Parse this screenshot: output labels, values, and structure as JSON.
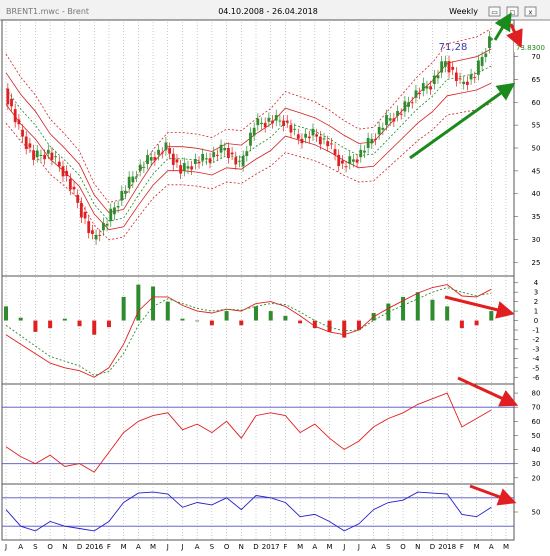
{
  "window": {
    "title": "BRENT1.mwc - Brent",
    "date_range": "04.10.2008 - 26.04.2018",
    "period": "Weekly",
    "btn_minimize": "▭",
    "btn_maximize": "◻",
    "btn_close": "x"
  },
  "colors": {
    "bull_candle": "#2e8b2e",
    "bear_candle": "#e02020",
    "neutral_candle": "#1f2fbf",
    "bands": "#d42020",
    "arrow_green": "#1a8a1a",
    "arrow_red": "#e02020",
    "grid": "#9a9a9a",
    "level_line": "#5050c8",
    "rsi_line": "#e02020",
    "stoch_line": "#2020c8"
  },
  "chart_data": [
    {
      "type": "candlestick",
      "name": "price",
      "yticks": [
        25,
        30,
        35,
        40,
        45,
        50,
        55,
        60,
        65,
        70
      ],
      "ylim": [
        22,
        78
      ],
      "last_price_label": "73.8300",
      "annotations": [
        {
          "text": "71,28"
        }
      ],
      "x": [
        "2015-07",
        "2015-08",
        "2015-09",
        "2015-10",
        "2015-11",
        "2015-12",
        "2016-01",
        "2016-02",
        "2016-03",
        "2016-04",
        "2016-05",
        "2016-06",
        "2016-07",
        "2016-08",
        "2016-09",
        "2016-10",
        "2016-11",
        "2016-12",
        "2017-01",
        "2017-02",
        "2017-03",
        "2017-04",
        "2017-05",
        "2017-06",
        "2017-07",
        "2017-08",
        "2017-09",
        "2017-10",
        "2017-11",
        "2017-12",
        "2018-01",
        "2018-02",
        "2018-03",
        "2018-04"
      ],
      "close": [
        63,
        54,
        48,
        49,
        45,
        38,
        30,
        34,
        40,
        45,
        48,
        50,
        45,
        47,
        48,
        50,
        46,
        55,
        56,
        56,
        52,
        53,
        51,
        46,
        48,
        52,
        56,
        58,
        62,
        64,
        69,
        64,
        66,
        73.83
      ]
    },
    {
      "type": "histogram+line",
      "name": "momentum oscillator",
      "yticks": [
        4,
        3,
        2,
        1,
        0,
        -1,
        -2,
        -3,
        -4,
        -5,
        -6
      ],
      "ylim": [
        -6.5,
        4.5
      ],
      "x": [
        "2015-07",
        "2015-08",
        "2015-09",
        "2015-10",
        "2015-11",
        "2015-12",
        "2016-01",
        "2016-02",
        "2016-03",
        "2016-04",
        "2016-05",
        "2016-06",
        "2016-07",
        "2016-08",
        "2016-09",
        "2016-10",
        "2016-11",
        "2016-12",
        "2017-01",
        "2017-02",
        "2017-03",
        "2017-04",
        "2017-05",
        "2017-06",
        "2017-07",
        "2017-08",
        "2017-09",
        "2017-10",
        "2017-11",
        "2017-12",
        "2018-01",
        "2018-02",
        "2018-03",
        "2018-04"
      ],
      "histogram": [
        1.5,
        0.3,
        -1.2,
        -0.8,
        0.2,
        -0.6,
        -1.5,
        -0.7,
        2.5,
        3.8,
        3.6,
        2.0,
        0.2,
        0.0,
        -0.5,
        1.0,
        -0.5,
        1.5,
        1.0,
        0.5,
        -0.3,
        -0.8,
        -1.2,
        -1.8,
        -1.0,
        0.8,
        1.8,
        2.5,
        3.0,
        2.2,
        1.5,
        -0.8,
        -0.5,
        1.0
      ],
      "line1": [
        -1.5,
        -2.5,
        -3.5,
        -4.5,
        -5.0,
        -5.3,
        -6.0,
        -5.0,
        -2.5,
        1.0,
        2.5,
        2.5,
        1.6,
        1.0,
        0.8,
        1.2,
        1.0,
        1.8,
        2.0,
        1.5,
        0.5,
        -0.6,
        -1.2,
        -1.5,
        -1.0,
        0.4,
        1.3,
        2.1,
        2.9,
        3.5,
        3.8,
        2.6,
        2.5,
        3.3
      ],
      "line2": [
        -0.5,
        -1.6,
        -2.7,
        -3.8,
        -4.3,
        -4.8,
        -5.8,
        -5.4,
        -3.5,
        -0.5,
        1.5,
        2.3,
        1.8,
        1.3,
        1.0,
        1.2,
        1.1,
        1.5,
        1.8,
        1.7,
        0.9,
        0.0,
        -0.7,
        -1.1,
        -1.0,
        0.0,
        0.9,
        1.6,
        2.3,
        3.0,
        3.5,
        3.0,
        2.6,
        2.9
      ]
    },
    {
      "type": "line",
      "name": "oscillator 1",
      "yticks": [
        80,
        70,
        60,
        50,
        40,
        30,
        20
      ],
      "ylim": [
        17,
        85
      ],
      "levels": [
        70,
        30
      ],
      "x": [
        "2015-07",
        "2015-08",
        "2015-09",
        "2015-10",
        "2015-11",
        "2015-12",
        "2016-01",
        "2016-02",
        "2016-03",
        "2016-04",
        "2016-05",
        "2016-06",
        "2016-07",
        "2016-08",
        "2016-09",
        "2016-10",
        "2016-11",
        "2016-12",
        "2017-01",
        "2017-02",
        "2017-03",
        "2017-04",
        "2017-05",
        "2017-06",
        "2017-07",
        "2017-08",
        "2017-09",
        "2017-10",
        "2017-11",
        "2017-12",
        "2018-01",
        "2018-02",
        "2018-03",
        "2018-04"
      ],
      "values": [
        42,
        35,
        30,
        36,
        28,
        30,
        24,
        38,
        52,
        60,
        64,
        66,
        54,
        58,
        52,
        60,
        48,
        64,
        66,
        64,
        52,
        58,
        48,
        40,
        46,
        56,
        62,
        66,
        72,
        76,
        80,
        56,
        62,
        68
      ]
    },
    {
      "type": "line",
      "name": "oscillator 2",
      "yticks": [
        50
      ],
      "ylim": [
        -5,
        105
      ],
      "levels": [
        80,
        20
      ],
      "x": [
        "2015-07",
        "2015-08",
        "2015-09",
        "2015-10",
        "2015-11",
        "2015-12",
        "2016-01",
        "2016-02",
        "2016-03",
        "2016-04",
        "2016-05",
        "2016-06",
        "2016-07",
        "2016-08",
        "2016-09",
        "2016-10",
        "2016-11",
        "2016-12",
        "2017-01",
        "2017-02",
        "2017-03",
        "2017-04",
        "2017-05",
        "2017-06",
        "2017-07",
        "2017-08",
        "2017-09",
        "2017-10",
        "2017-11",
        "2017-12",
        "2018-01",
        "2018-02",
        "2018-03",
        "2018-04"
      ],
      "values": [
        55,
        20,
        10,
        30,
        20,
        15,
        10,
        30,
        70,
        90,
        92,
        88,
        60,
        70,
        65,
        80,
        55,
        85,
        80,
        70,
        40,
        45,
        30,
        10,
        25,
        55,
        70,
        75,
        92,
        90,
        88,
        45,
        40,
        60
      ]
    }
  ],
  "x_axis": {
    "labels": [
      "J",
      "A",
      "S",
      "O",
      "N",
      "D",
      "2016",
      "F",
      "M",
      "A",
      "M",
      "J",
      "J",
      "A",
      "S",
      "O",
      "N",
      "D",
      "2017",
      "F",
      "M",
      "A",
      "M",
      "J",
      "J",
      "A",
      "S",
      "O",
      "N",
      "D",
      "2018",
      "F",
      "M",
      "A",
      "M"
    ]
  }
}
